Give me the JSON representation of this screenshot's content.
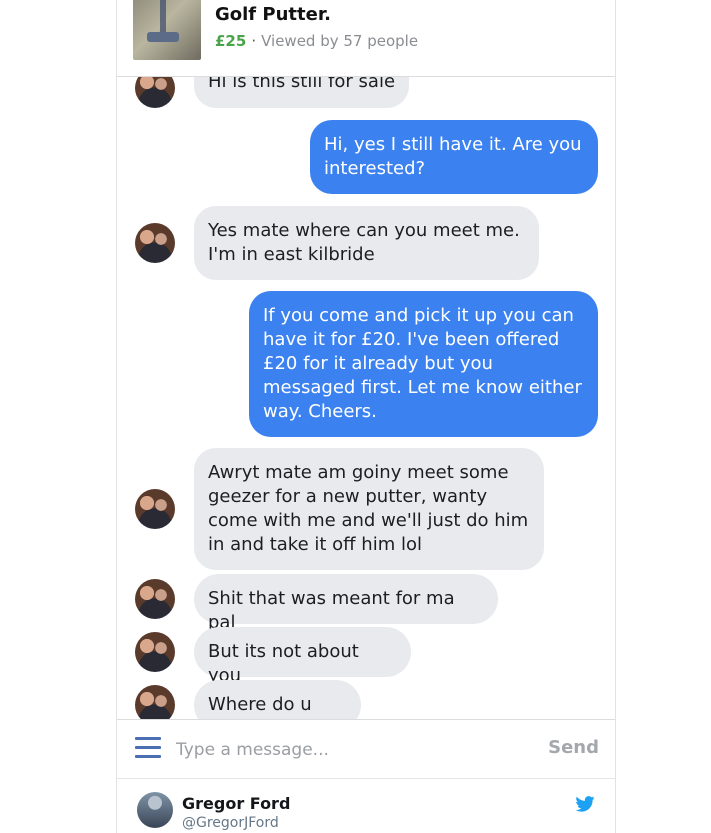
{
  "listing": {
    "title": "Golf Putter.",
    "price": "£25",
    "separator": "·",
    "viewed": "Viewed by 57 people"
  },
  "messages": [
    {
      "from": "them",
      "text": "Hi is this still for sale"
    },
    {
      "from": "me",
      "text": "Hi, yes I still have it. Are you\ninterested?"
    },
    {
      "from": "them",
      "text": "Yes mate where can you meet me.\nI'm in east kilbride"
    },
    {
      "from": "me",
      "text": "If you come and pick it up you can\nhave it for £20. I've been offered\n£20 for it already but you\nmessaged first. Let me know either\nway. Cheers."
    },
    {
      "from": "them",
      "text": "Awryt mate am goiny meet some\ngeezer for a new putter, wanty\ncome with me and we'll just do him\nin and take it off him lol"
    },
    {
      "from": "them",
      "text": "Shit that was meant for ma pal"
    },
    {
      "from": "them",
      "text": "But its not about you"
    },
    {
      "from": "them",
      "text": "Where do u live"
    }
  ],
  "composer": {
    "placeholder": "Type a message...",
    "send_label": "Send"
  },
  "tweet": {
    "author_name": "Gregor Ford",
    "author_handle": "@GregorJFord",
    "bird_color": "#1da1f2"
  }
}
